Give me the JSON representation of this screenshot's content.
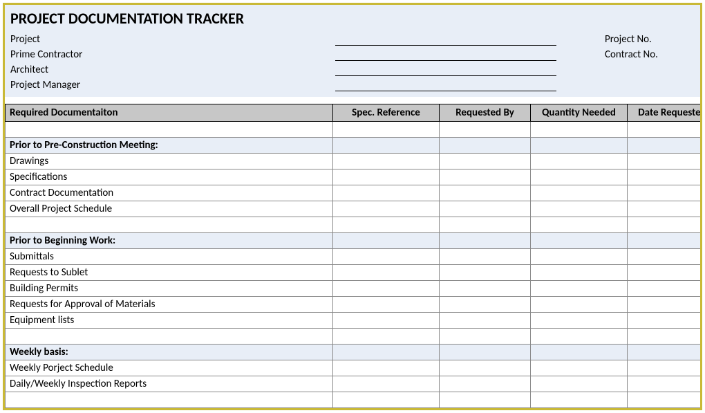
{
  "title": "PROJECT DOCUMENTATION TRACKER",
  "meta": {
    "project_label": "Project",
    "prime_contractor_label": "Prime Contractor",
    "architect_label": "Architect",
    "project_manager_label": "Project Manager",
    "project_no_label": "Project No.",
    "contract_no_label": "Contract No."
  },
  "columns": {
    "doc": "Required Documentaiton",
    "spec": "Spec. Reference",
    "req": "Requested By",
    "qty": "Quantity Needed",
    "date": "Date Requested"
  },
  "sections": [
    {
      "header": "Prior to Pre-Construction Meeting:",
      "rows": [
        "Drawings",
        "Specifications",
        "Contract Documentation",
        "Overall Project Schedule"
      ]
    },
    {
      "header": "Prior to Beginning Work:",
      "rows": [
        "Submittals",
        "Requests to Sublet",
        "Building Permits",
        "Requests for Approval of Materials",
        "Equipment lists"
      ]
    },
    {
      "header": "Weekly basis:",
      "rows": [
        "Weekly Porject Schedule",
        "Daily/Weekly Inspection Reports"
      ]
    }
  ]
}
